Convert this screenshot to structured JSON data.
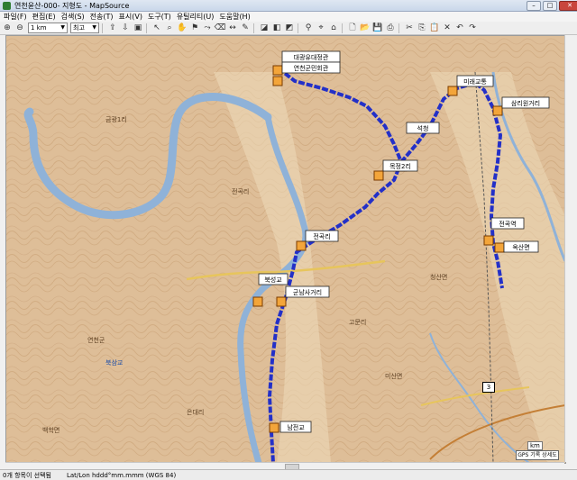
{
  "window": {
    "title": "연천윤산-000- 지형도 - MapSource"
  },
  "menu": [
    "파일(F)",
    "편집(E)",
    "검색(S)",
    "전송(T)",
    "표시(V)",
    "도구(T)",
    "유틸리티(U)",
    "도움말(H)"
  ],
  "toolbar": {
    "scale_value": "1 km",
    "detail_value": "최고"
  },
  "waypoints": [
    "대광유대정관",
    "연천군민회관",
    "석청",
    "목정2리",
    "전곡리",
    "북성교",
    "군남사거리",
    "미래교통",
    "삼리원거리",
    "전곡역",
    "옥산면",
    "남전교"
  ],
  "map_labels": [
    "금광1리",
    "전곡리",
    "연천군",
    "북삼교",
    "은대리",
    "고문리",
    "백학면",
    "청산면",
    "미산면"
  ],
  "road_shield": "3",
  "scale_label": "km",
  "gps_label": "GPS 기록 상세도",
  "status": {
    "left": "0개 항목이 선택됨",
    "coords": "Lat/Lon hddd°mm.mmm (WGS 84)"
  },
  "colors": {
    "terrain": "#d9b58f",
    "river": "#8fb2d8",
    "route": "#2330c8",
    "road": "#e7c55c"
  }
}
